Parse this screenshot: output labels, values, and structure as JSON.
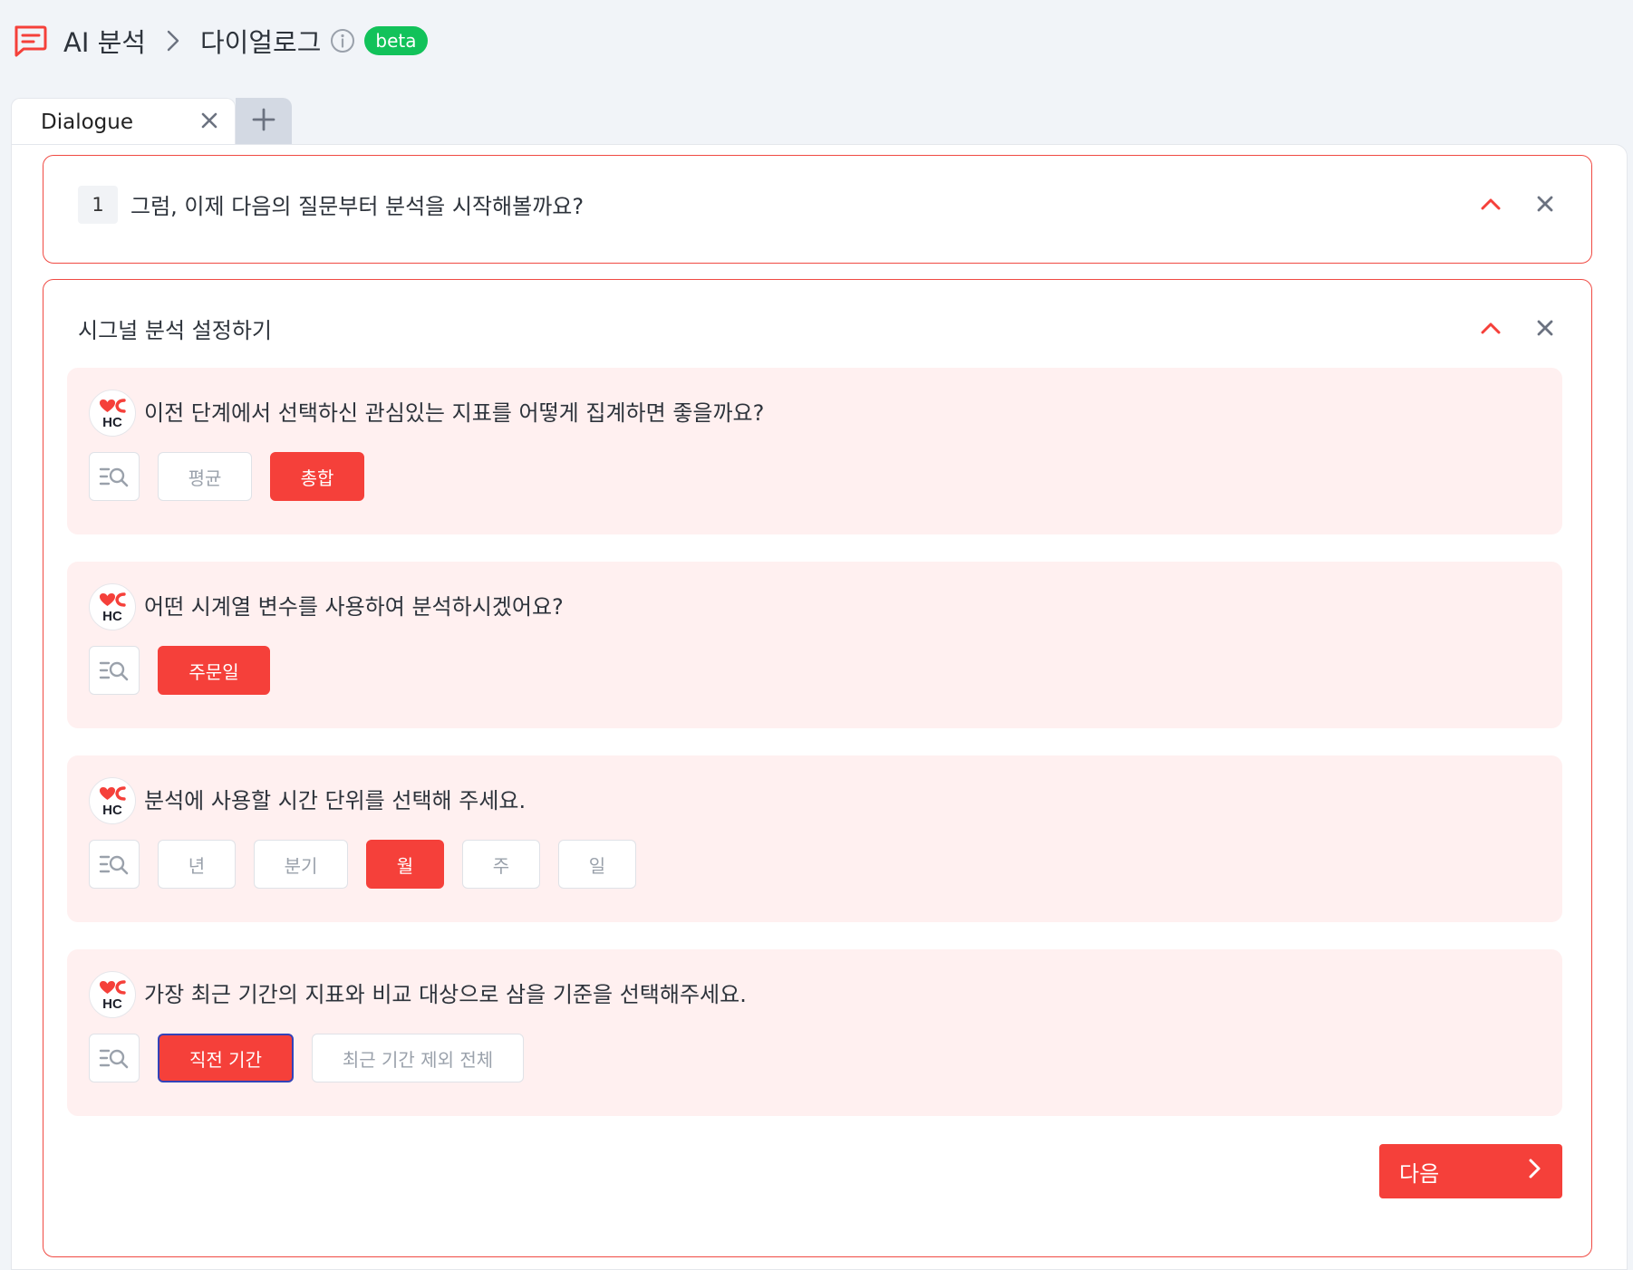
{
  "header": {
    "root_label": "AI 분석",
    "current_label": "다이얼로그",
    "badge": "beta",
    "accent_color": "#f5403a",
    "badge_color": "#12c25a"
  },
  "tabs": [
    {
      "label": "Dialogue"
    }
  ],
  "question_card": {
    "number": "1",
    "title": "그럼, 이제 다음의 질문부터 분석을 시작해볼까요?"
  },
  "section": {
    "title": "시그널 분석 설정하기",
    "avatar_text": "HC",
    "questions": [
      {
        "text": "이전 단계에서 선택하신 관심있는 지표를 어떻게 집계하면 좋을까요?",
        "options": [
          "평균",
          "총합"
        ],
        "selected": "총합"
      },
      {
        "text": "어떤 시계열 변수를 사용하여 분석하시겠어요?",
        "options": [
          "주문일"
        ],
        "selected": "주문일"
      },
      {
        "text": "분석에 사용할 시간 단위를 선택해 주세요.",
        "options": [
          "년",
          "분기",
          "월",
          "주",
          "일"
        ],
        "selected": "월"
      },
      {
        "text": "가장 최근 기간의 지표와 비교 대상으로 삼을 기준을 선택해주세요.",
        "options": [
          "직전 기간",
          "최근 기간 제외 전체"
        ],
        "selected": "직전 기간"
      }
    ],
    "next_label": "다음"
  }
}
